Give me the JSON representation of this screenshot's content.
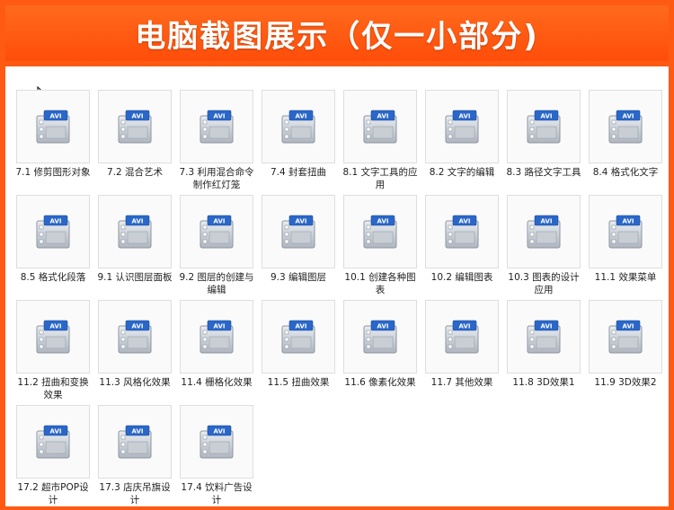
{
  "banner": {
    "title": "电脑截图展示（仅一小部分)"
  },
  "file_icon": {
    "name": "avi-file-icon",
    "badge_text": "AVI",
    "accent": "#2a67c9"
  },
  "files": [
    {
      "label": "7.1  修剪图形对象"
    },
    {
      "label": "7.2  混合艺术"
    },
    {
      "label": "7.3  利用混合命令制作红灯笼"
    },
    {
      "label": "7.4  封套扭曲"
    },
    {
      "label": "8.1  文字工具的应用"
    },
    {
      "label": "8.2  文字的编辑"
    },
    {
      "label": "8.3  路径文字工具"
    },
    {
      "label": "8.4  格式化文字"
    },
    {
      "label": "8.5  格式化段落"
    },
    {
      "label": "9.1  认识图层面板"
    },
    {
      "label": "9.2  图层的创建与编辑"
    },
    {
      "label": "9.3  编辑图层"
    },
    {
      "label": "10.1  创建各种图表"
    },
    {
      "label": "10.2  编辑图表"
    },
    {
      "label": "10.3  图表的设计应用"
    },
    {
      "label": "11.1  效果菜单"
    },
    {
      "label": "11.2  扭曲和变换效果"
    },
    {
      "label": "11.3  风格化效果"
    },
    {
      "label": "11.4  栅格化效果"
    },
    {
      "label": "11.5  扭曲效果"
    },
    {
      "label": "11.6 像素化效果"
    },
    {
      "label": "11.7  其他效果"
    },
    {
      "label": "11.8  3D效果1"
    },
    {
      "label": "11.9  3D效果2"
    },
    {
      "label": "17.2  超市POP设计"
    },
    {
      "label": "17.3  店庆吊旗设计"
    },
    {
      "label": "17.4  饮料广告设计"
    }
  ]
}
